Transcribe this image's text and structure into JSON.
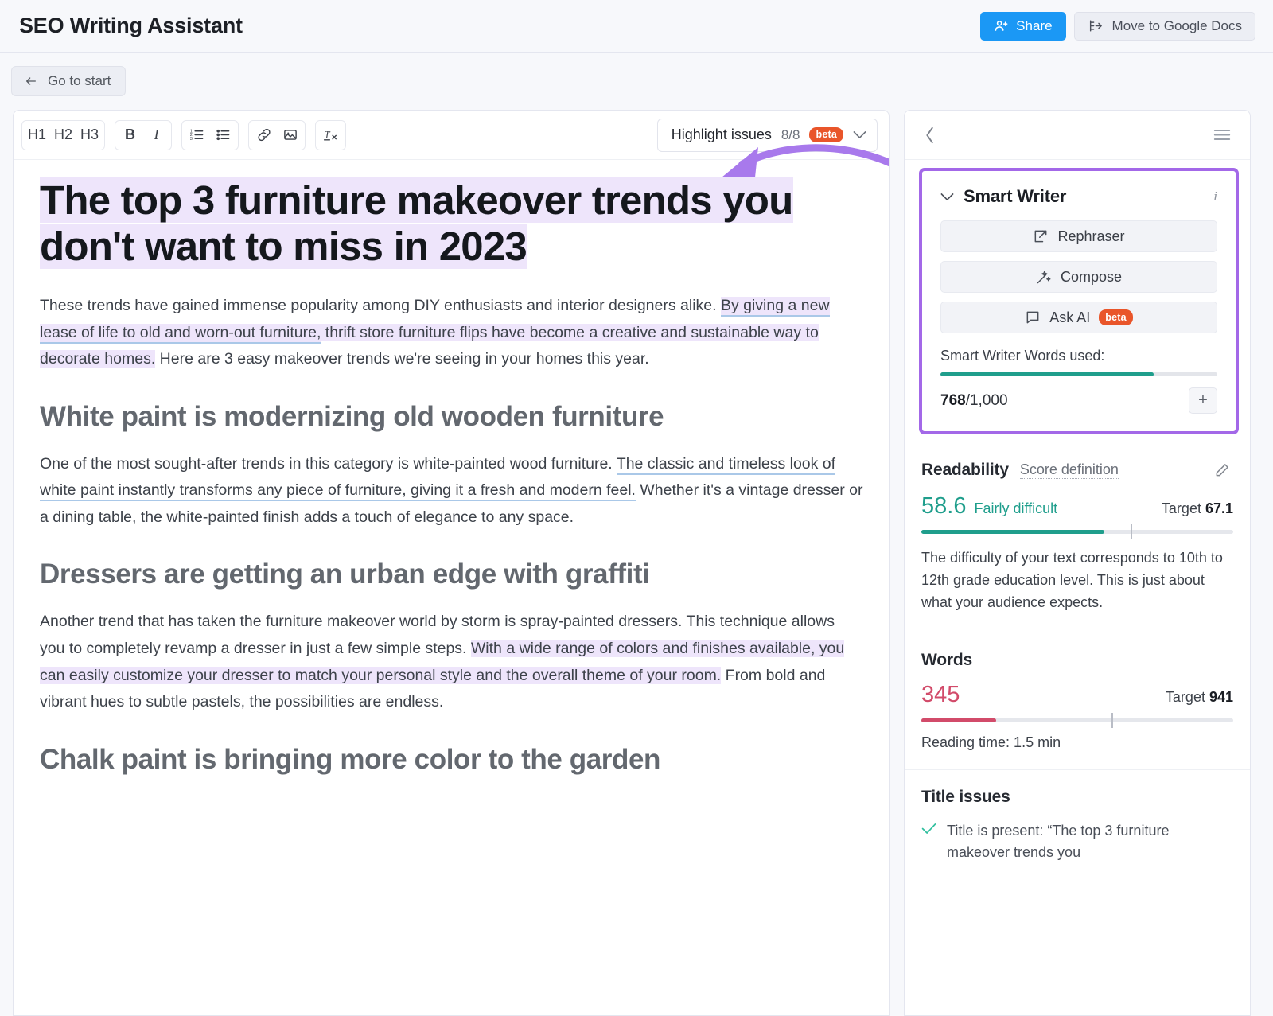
{
  "header": {
    "title": "SEO Writing Assistant",
    "share_label": "Share",
    "move_label": "Move to Google Docs",
    "goto_start_label": "Go to start"
  },
  "editor": {
    "toolbar": {
      "h1": "H1",
      "h2": "H2",
      "h3": "H3",
      "bold": "B",
      "italic": "I",
      "ordered_list": "ordered-list-icon",
      "bullet_list": "bullet-list-icon",
      "link": "link-icon",
      "image": "image-icon",
      "clear_format": "clear-format-icon"
    },
    "highlight": {
      "label": "Highlight issues",
      "count": "8/8",
      "badge": "beta"
    }
  },
  "document": {
    "title": "The top 3 furniture makeover trends you don't want to miss in 2023",
    "intro": {
      "part1": "These trends have gained immense popularity among DIY enthusiasts and interior designers alike. ",
      "underlined": "By giving a new lease of life to old and worn-out furniture,",
      "part2": " thrift store furniture flips have become a creative and sustainable way to decorate homes.",
      "part3": " Here are 3 easy makeover trends we're seeing in your homes this year."
    },
    "section1": {
      "heading": "White paint is modernizing old wooden furniture",
      "part1": "One of the most sought-after trends in this category is white-painted wood furniture. ",
      "underlined": "The classic and timeless look of white paint instantly transforms any piece of furniture, giving it a fresh and modern feel.",
      "part2": " Whether it's a vintage dresser or a dining table, the white-painted finish adds a touch of elegance to any space."
    },
    "section2": {
      "heading": "Dressers are getting an urban edge with graffiti",
      "part1": "Another trend that has taken the furniture makeover world by storm is spray-painted dressers. This technique allows you to completely revamp a dresser in just a few simple steps. ",
      "highlighted": "With a wide range of colors and finishes available, you can easily customize your dresser to match your personal style and the overall theme of your room.",
      "part2": " From bold and vibrant hues to subtle pastels, the possibilities are endless."
    },
    "section3": {
      "heading": "Chalk paint is bringing more color to the garden"
    }
  },
  "sidebar": {
    "collapse_icon": "chevron-left-icon",
    "menu_icon": "hamburger-menu-icon",
    "smart_writer": {
      "title": "Smart Writer",
      "info_icon": "info-icon",
      "rephraser_label": "Rephraser",
      "compose_label": "Compose",
      "ask_ai_label": "Ask AI",
      "ask_ai_badge": "beta",
      "words_used_label": "Smart Writer Words used:",
      "used": "768",
      "total": "/1,000",
      "progress_percent": 77,
      "progress_color": "#1f9e8c",
      "add_button": "+",
      "highlight_color": "#a368e8"
    },
    "readability": {
      "title": "Readability",
      "link": "Score definition",
      "edit_icon": "pencil-icon",
      "score": "58.6",
      "state": "Fairly difficult",
      "target_label": "Target ",
      "target_value": "67.1",
      "score_color": "#1f9e8c",
      "progress_percent": 58.6,
      "target_percent": 67.1,
      "description": "The difficulty of your text corresponds to 10th to 12th grade education level. This is just about what your audience expects."
    },
    "words": {
      "title": "Words",
      "value": "345",
      "target_label": "Target ",
      "target_value": "941",
      "value_color": "#d24b6a",
      "progress_percent": 24,
      "target_percent": 61,
      "reading_time": "Reading time: 1.5 min"
    },
    "title_issues": {
      "title": "Title issues",
      "items": [
        {
          "status": "ok",
          "text": "Title is present: “The top 3 furniture makeover trends you"
        }
      ]
    }
  }
}
